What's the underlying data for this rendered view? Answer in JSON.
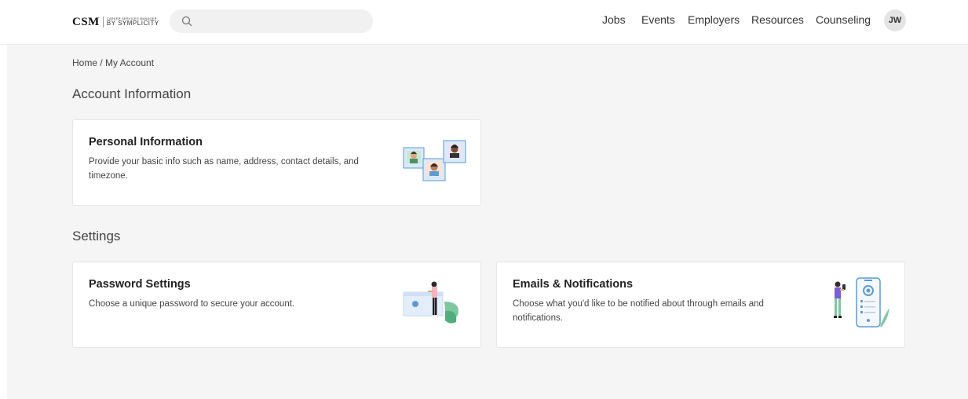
{
  "header": {
    "logo_main": "CSM",
    "logo_tiny": "CAREER SERVICES MANAGER",
    "logo_by": "BY SYMPLICITY",
    "search_placeholder": "",
    "nav": [
      "Jobs",
      "Events",
      "Employers",
      "Resources",
      "Counseling"
    ],
    "avatar_initials": "JW"
  },
  "breadcrumb": "Home / My Account",
  "sections": {
    "account": {
      "title": "Account Information",
      "cards": [
        {
          "title": "Personal Information",
          "description": "Provide your basic info such as name, address, contact details, and timezone.",
          "icon": "people-profiles-illustration"
        }
      ]
    },
    "settings": {
      "title": "Settings",
      "cards": [
        {
          "title": "Password Settings",
          "description": "Choose a unique password to secure your account.",
          "icon": "password-illustration"
        },
        {
          "title": "Emails & Notifications",
          "description": "Choose what you'd like to be notified about through emails and notifications.",
          "icon": "notifications-illustration"
        }
      ]
    }
  },
  "colors": {
    "background": "#f5f5f5",
    "card": "#ffffff",
    "accent_blue": "#5b9bd5",
    "accent_green": "#7fc7a0"
  }
}
